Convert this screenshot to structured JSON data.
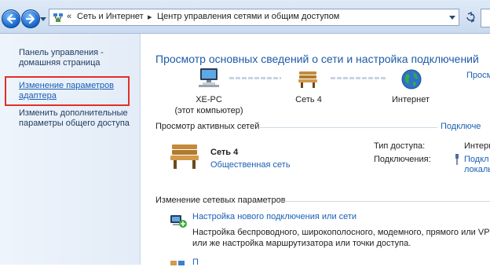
{
  "address_bar": {
    "prefix": "«",
    "crumbs": [
      "Сеть и Интернет",
      "Центр управления сетями и общим доступом"
    ],
    "separator": "▸"
  },
  "left_panel": {
    "home_line1": "Панель управления -",
    "home_line2": "домашняя страница",
    "adapter_line1": "Изменение параметров",
    "adapter_line2": "адаптера",
    "sharing_line1": "Изменить дополнительные",
    "sharing_line2": "параметры общего доступа"
  },
  "main": {
    "title": "Просмотр основных сведений о сети и настройка подключений",
    "title_link": "Просм",
    "network_map": {
      "computer_name": "XE-PC",
      "computer_sub": "(этот компьютер)",
      "network_name": "Сеть  4",
      "internet": "Интернет"
    },
    "active_networks_header": "Просмотр активных сетей",
    "active_networks_link": "Подключе",
    "active_network": {
      "name": "Сеть  4",
      "type": "Общественная сеть",
      "access_label": "Тип доступа:",
      "access_value": "Интерн",
      "connections_label": "Подключения:",
      "connections_value_line1": "Подкл",
      "connections_value_line2": "локаль"
    },
    "change_settings_header": "Изменение сетевых параметров",
    "task1": {
      "title": "Настройка нового подключения или сети",
      "desc_line1": "Настройка беспроводного, широкополосного, модемного, прямого или VPN",
      "desc_line2": "или же настройка маршрутизатора или точки доступа."
    },
    "task2_title": "П"
  }
}
